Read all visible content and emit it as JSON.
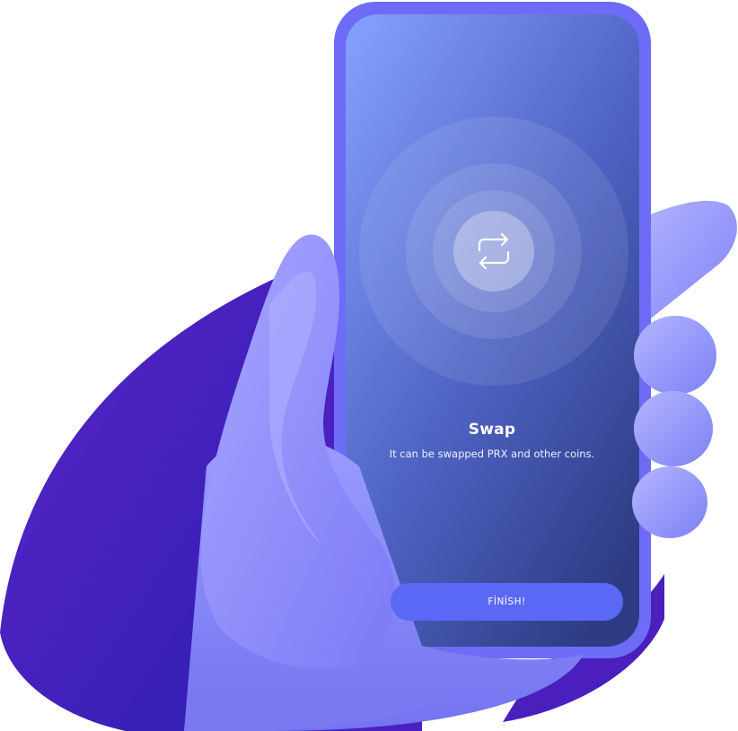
{
  "screen": {
    "title": "Swap",
    "subtitle": "It can be swapped PRX and other coins.",
    "icon": "swap-arrows-icon"
  },
  "actions": {
    "finish_label": "FİNİSH!"
  },
  "colors": {
    "blob_dark": "#3b1fb5",
    "blob_light": "#5a22c8",
    "phone_frame": "#6d6cf5",
    "screen_top": "#86a2ff",
    "screen_bottom": "#2f3f86",
    "hand": "#8c8cff",
    "button": "#5a68f5"
  }
}
